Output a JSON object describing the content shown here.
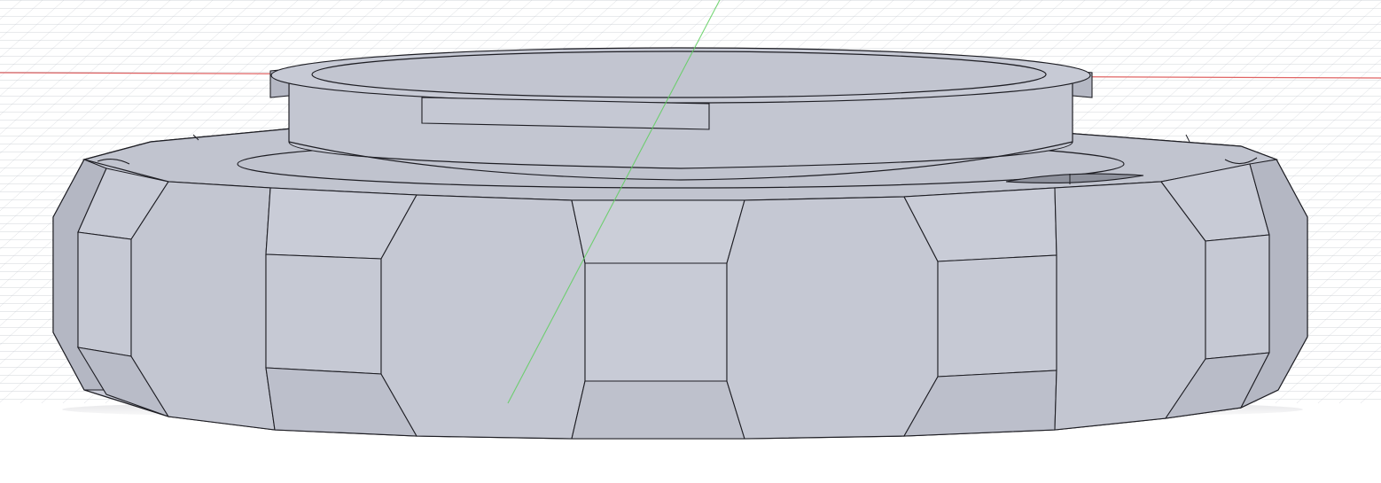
{
  "viewport": {
    "background": "#ffffff",
    "grid_color": "#c9cdd4",
    "axis_red": "#e06464",
    "axis_green": "#5fcf5f"
  },
  "model": {
    "body_color": "#c4c7d3",
    "face_dark": "#b1b4c1",
    "face_light": "#d2d5df",
    "top_color": "#c1c4cf",
    "edge_color": "#1e1e24"
  }
}
